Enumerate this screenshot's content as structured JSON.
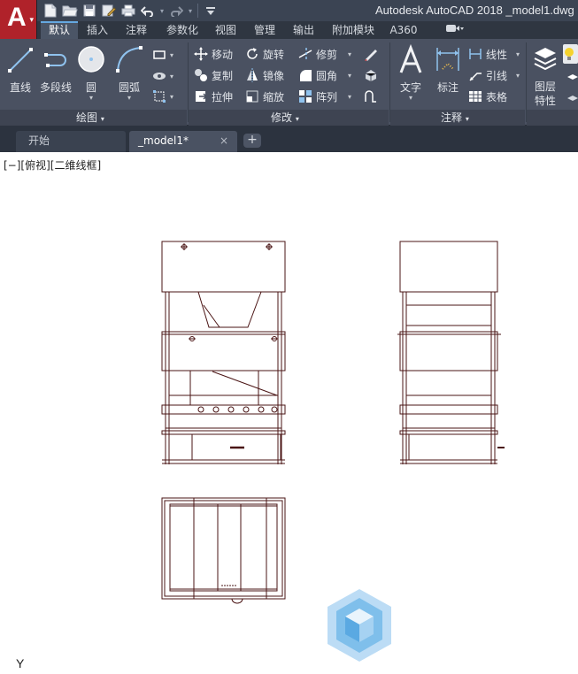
{
  "app": {
    "logo_letter": "A",
    "window_title": "Autodesk AutoCAD 2018    _model1.dwg"
  },
  "quick_access": {
    "icons": [
      "new-icon",
      "open-icon",
      "save-icon",
      "save-as-icon",
      "plot-icon",
      "undo-icon",
      "redo-icon",
      "customize-icon"
    ]
  },
  "ribbon_tabs": [
    "默认",
    "插入",
    "注释",
    "参数化",
    "视图",
    "管理",
    "输出",
    "附加模块",
    "A360"
  ],
  "ribbon_extra_icon": "video-icon",
  "ribbon": {
    "draw": {
      "title": "绘图",
      "line": "直线",
      "polyline": "多段线",
      "circle": "圆",
      "arc": "圆弧"
    },
    "modify": {
      "title": "修改",
      "move": "移动",
      "rotate": "旋转",
      "trim": "修剪",
      "copy": "复制",
      "mirror": "镜像",
      "fillet": "圆角",
      "stretch": "拉伸",
      "scale": "缩放",
      "array": "阵列"
    },
    "annotation": {
      "title": "注释",
      "text": "文字",
      "dimension": "标注",
      "linear": "线性",
      "leader": "引线",
      "table": "表格"
    },
    "layers": {
      "title": "图层",
      "properties_line1": "图层",
      "properties_line2": "特性"
    }
  },
  "doc_tabs": {
    "start": "开始",
    "model": "_model1*",
    "close_glyph": "×",
    "add_glyph": "+"
  },
  "canvas": {
    "viewport_label": "[−][俯视][二维线框]",
    "ucs_label": "Y",
    "background": "#ffffff",
    "line_color": "#4a1414"
  },
  "colors": {
    "titlebar": "#3b4453",
    "ribbon": "#4a5161",
    "app_button": "#b0222a",
    "active_tab_accent": "#65a8e0"
  }
}
